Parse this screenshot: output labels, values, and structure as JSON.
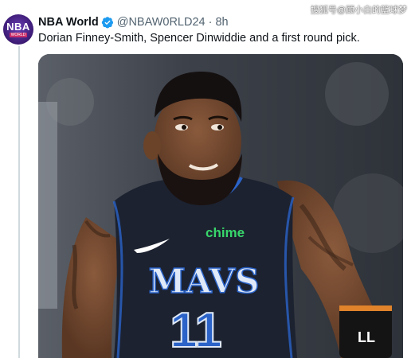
{
  "watermark": "搜狐号@顾小白的篮球梦",
  "account": {
    "avatar_text": "NBA",
    "avatar_sub": "WORLD",
    "display_name": "NBA World",
    "handle": "@NBAW0RLD24",
    "separator": "·",
    "time": "8h"
  },
  "tweet": {
    "text": "Dorian Finney-Smith, Spencer Dinwiddie and a first round pick."
  },
  "media": {
    "sponsor": "chime",
    "jersey_team": "MAVS",
    "jersey_number": "11",
    "armband_text": "LL"
  },
  "colors": {
    "verified": "#1d9bf0",
    "jersey": "#1c2230",
    "jersey_trim": "#2b63c8",
    "sponsor": "#38d66b"
  }
}
